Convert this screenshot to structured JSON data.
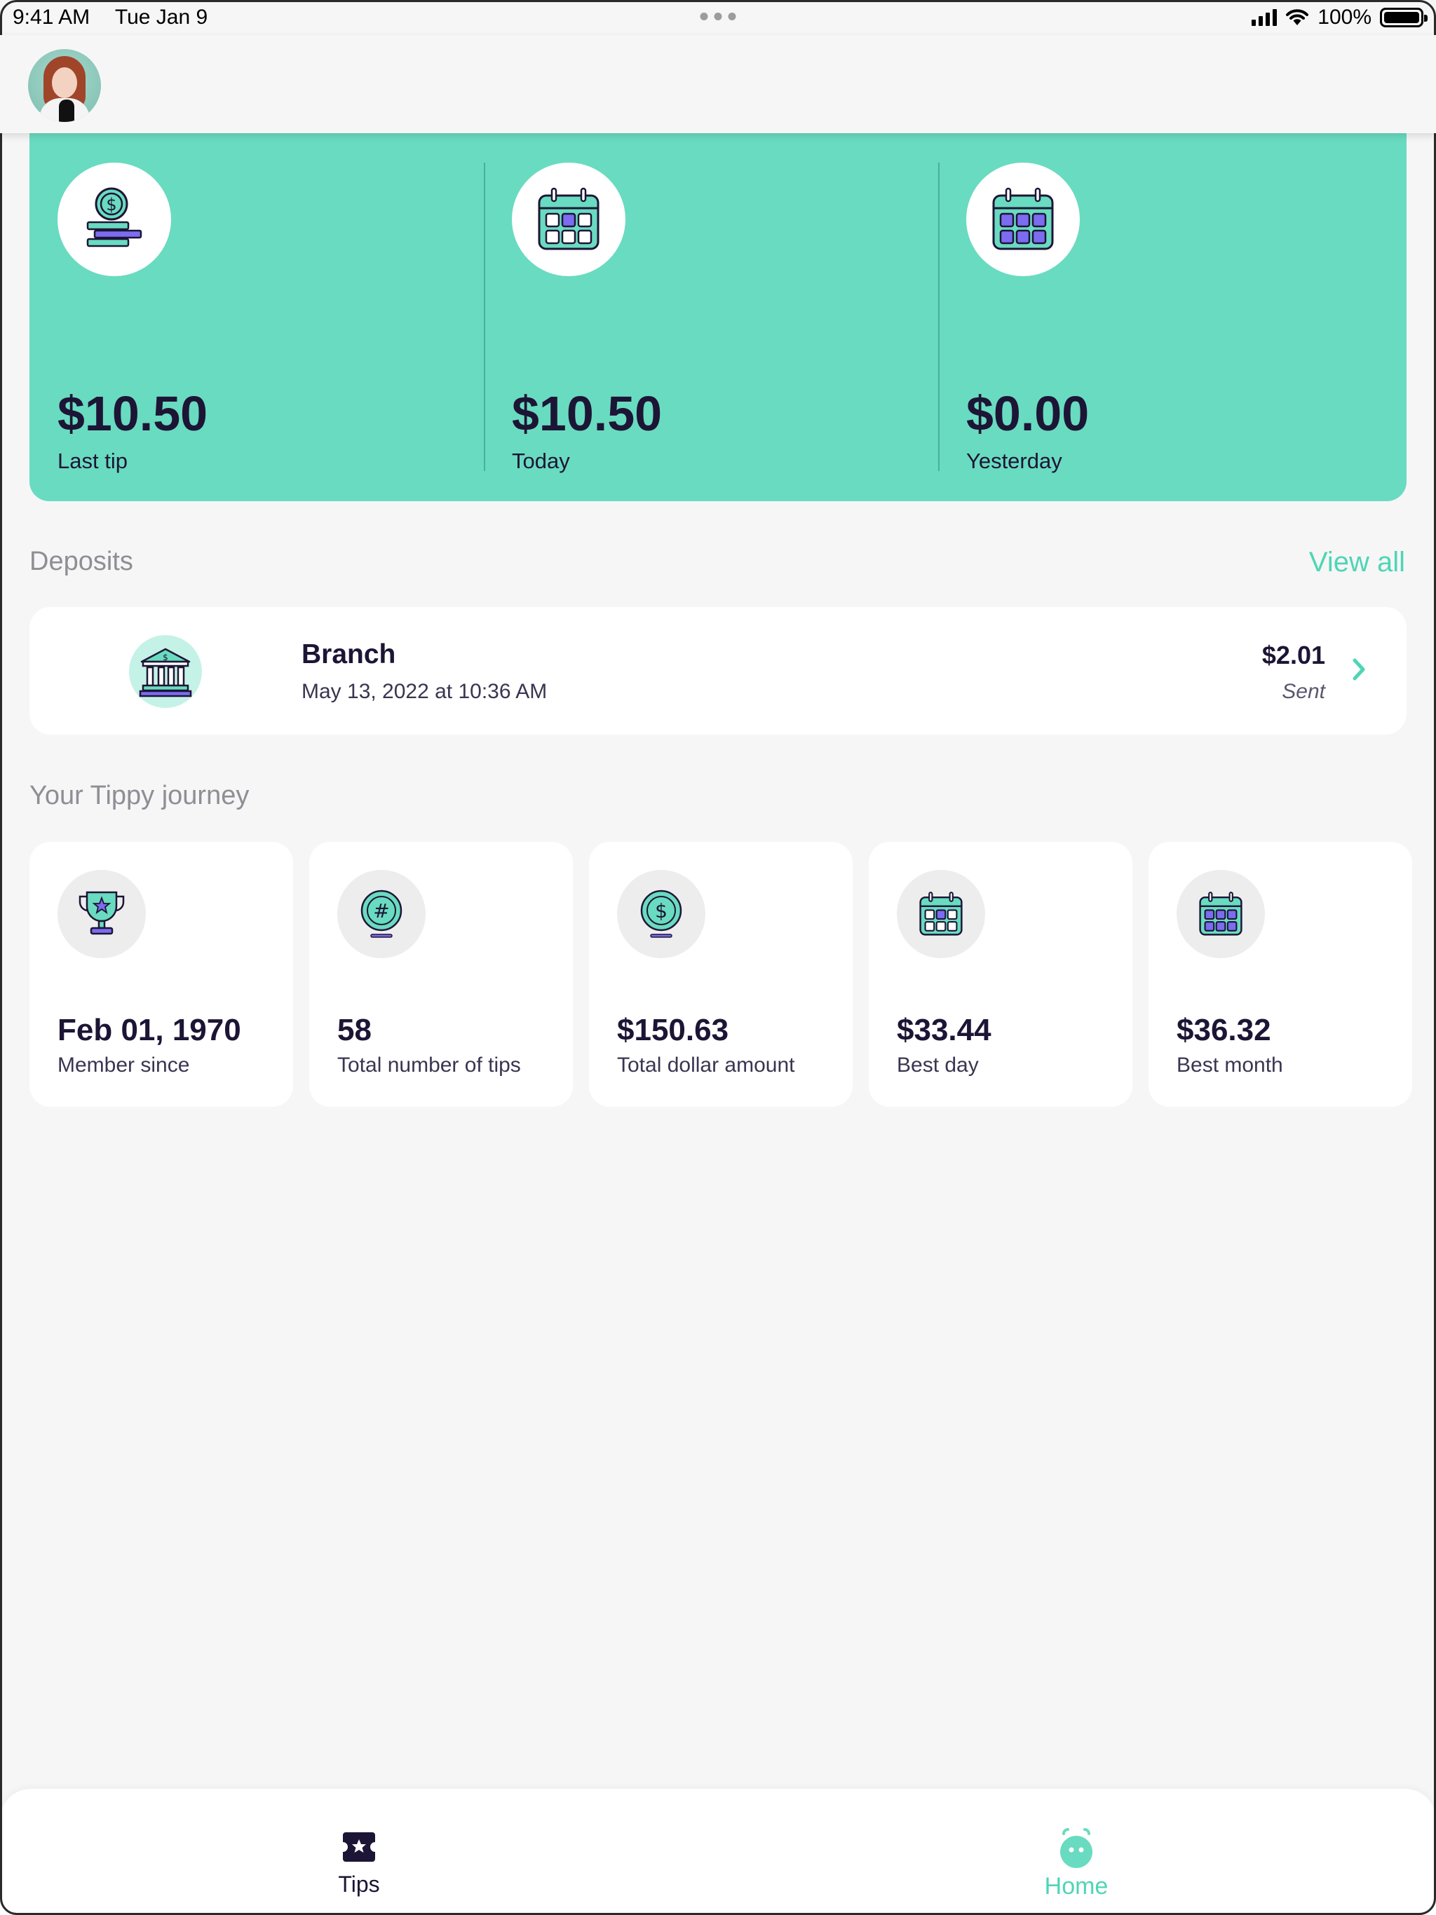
{
  "status_bar": {
    "time": "9:41 AM",
    "date": "Tue Jan 9",
    "battery": "100%"
  },
  "summary": [
    {
      "amount": "$10.50",
      "label": "Last tip",
      "icon": "coins-icon"
    },
    {
      "amount": "$10.50",
      "label": "Today",
      "icon": "calendar-day-icon"
    },
    {
      "amount": "$0.00",
      "label": "Yesterday",
      "icon": "calendar-full-icon"
    }
  ],
  "deposits": {
    "title": "Deposits",
    "view_all": "View all",
    "items": [
      {
        "name": "Branch",
        "date": "May 13, 2022 at 10:36 AM",
        "amount": "$2.01",
        "status": "Sent",
        "icon": "bank-icon"
      }
    ]
  },
  "journey": {
    "title": "Your Tippy journey",
    "cards": [
      {
        "value": "Feb 01, 1970",
        "label": "Member since",
        "icon": "trophy-icon"
      },
      {
        "value": "58",
        "label": "Total number of tips",
        "icon": "hash-coin-icon"
      },
      {
        "value": "$150.63",
        "label": "Total dollar amount",
        "icon": "dollar-coin-icon"
      },
      {
        "value": "$33.44",
        "label": "Best day",
        "icon": "calendar-day-icon"
      },
      {
        "value": "$36.32",
        "label": "Best month",
        "icon": "calendar-full-icon"
      }
    ]
  },
  "tab_bar": {
    "tips_label": "Tips",
    "home_label": "Home",
    "active": "Home"
  },
  "colors": {
    "accent": "#69dbc0",
    "accent_text": "#4fd5b6",
    "dark": "#1d1535",
    "purple": "#7b6cf0"
  }
}
